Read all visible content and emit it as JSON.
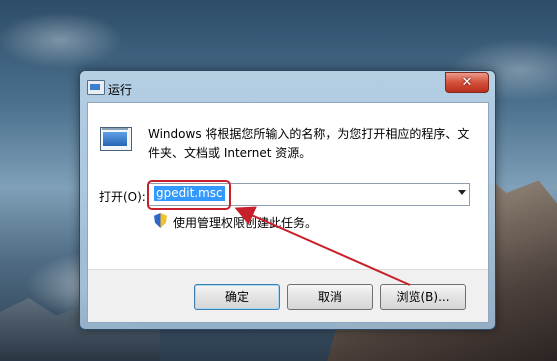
{
  "window": {
    "title": "运行",
    "close_glyph": "✕"
  },
  "dialog": {
    "description": "Windows 将根据您所输入的名称，为您打开相应的程序、文件夹、文档或 Internet 资源。",
    "open_label": "打开(O):",
    "command_value": "gpedit.msc",
    "admin_note": "使用管理权限创建此任务。"
  },
  "buttons": {
    "ok": "确定",
    "cancel": "取消",
    "browse": "浏览(B)..."
  },
  "annotation": {
    "color": "#c8202a"
  },
  "icons": [
    "run-icon",
    "close-icon",
    "shield-icon",
    "chevron-down-icon"
  ]
}
